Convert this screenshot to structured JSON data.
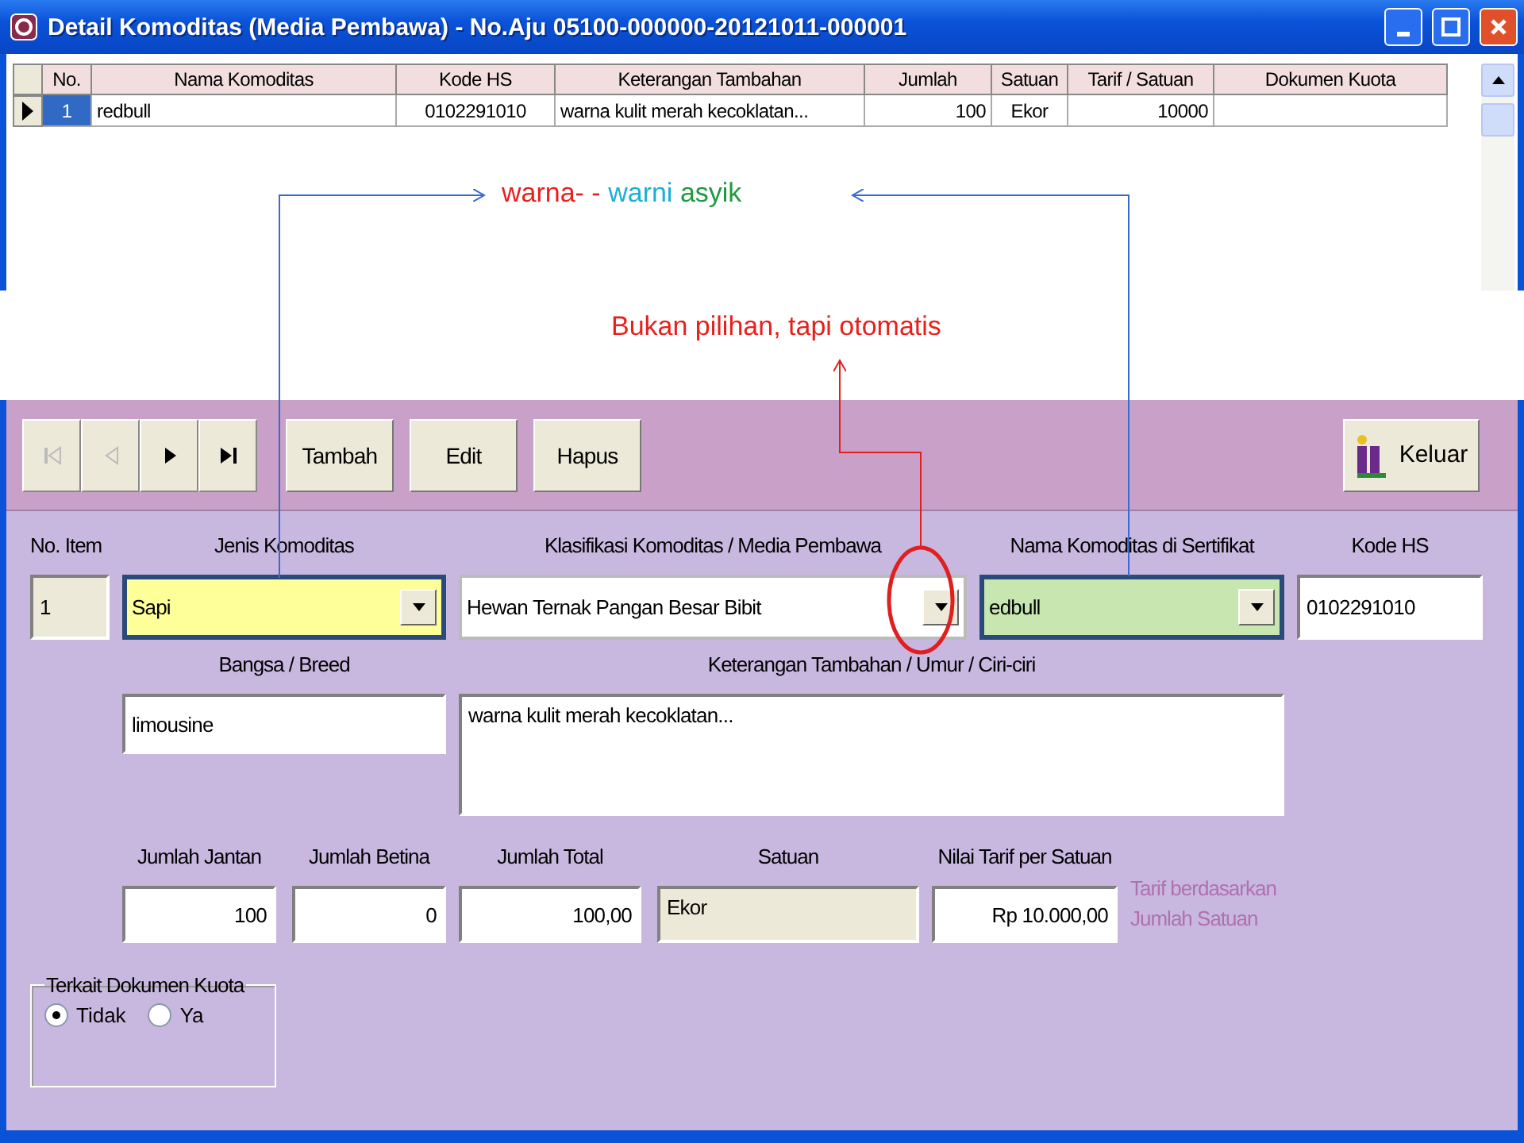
{
  "window": {
    "title": "Detail Komoditas (Media Pembawa) - No.Aju 05100-000000-20121011-000001"
  },
  "grid": {
    "columns": [
      "No.",
      "Nama Komoditas",
      "Kode HS",
      "Keterangan Tambahan",
      "Jumlah",
      "Satuan",
      "Tarif / Satuan",
      "Dokumen Kuota"
    ],
    "rows": [
      {
        "selected": true,
        "cells": [
          "1",
          "redbull",
          "0102291010",
          "warna kulit merah kecoklatan...",
          "100",
          "Ekor",
          "10000"
        ]
      }
    ]
  },
  "annotations": {
    "top": [
      {
        "text": "warna- -",
        "color": "#e8201c"
      },
      {
        "text": "warni",
        "color": "#1ab0d8"
      },
      {
        "text": "asyik",
        "color": "#1e9a40"
      }
    ],
    "note": {
      "text": "Bukan pilihan, tapi otomatis",
      "color": "#e8201c"
    }
  },
  "toolbar": {
    "nav_buttons": [
      {
        "kind": "first",
        "disabled": true
      },
      {
        "kind": "prev",
        "disabled": true
      },
      {
        "kind": "next",
        "disabled": false
      },
      {
        "kind": "last",
        "disabled": false
      }
    ],
    "buttons": [
      "Tambah",
      "Edit",
      "Hapus"
    ],
    "exit_button": "Keluar"
  },
  "form": {
    "identity_fields": [
      {
        "kind": "readonly",
        "label": "No. Item",
        "value": "1"
      },
      {
        "kind": "combo",
        "label": "Jenis Komoditas",
        "value": "Sapi",
        "color": "#ffff99"
      },
      {
        "kind": "combo",
        "label": "Klasifikasi Komoditas / Media Pembawa",
        "value": "Hewan Ternak Pangan Besar Bibit"
      },
      {
        "kind": "combo",
        "label": "Nama Komoditas di Sertifikat",
        "value": "edbull",
        "color": "#c8e6b0"
      },
      {
        "kind": "text",
        "label": "Kode HS",
        "value": "0102291010"
      }
    ],
    "description_fields": [
      {
        "kind": "text",
        "label": "Bangsa / Breed",
        "value": "limousine"
      },
      {
        "kind": "memo",
        "label": "Keterangan Tambahan / Umur / Ciri-ciri",
        "value": "warna kulit merah kecoklatan..."
      }
    ],
    "quantity_fields": [
      {
        "kind": "number",
        "label": "Jumlah Jantan",
        "value": "100"
      },
      {
        "kind": "number",
        "label": "Jumlah Betina",
        "value": "0"
      },
      {
        "kind": "number",
        "label": "Jumlah Total",
        "value": "100,00"
      },
      {
        "kind": "readonly",
        "label": "Satuan",
        "value": "Ekor"
      },
      {
        "kind": "number",
        "label": "Nilai Tarif per Satuan",
        "value": "Rp 10.000,00"
      }
    ],
    "tariff_note": "Tarif berdasarkan Jumlah Satuan",
    "quota_group": {
      "title": "Terkait Dokumen Kuota",
      "options": [
        {
          "label": "Tidak",
          "selected": true
        },
        {
          "label": "Ya",
          "selected": false
        }
      ]
    }
  }
}
